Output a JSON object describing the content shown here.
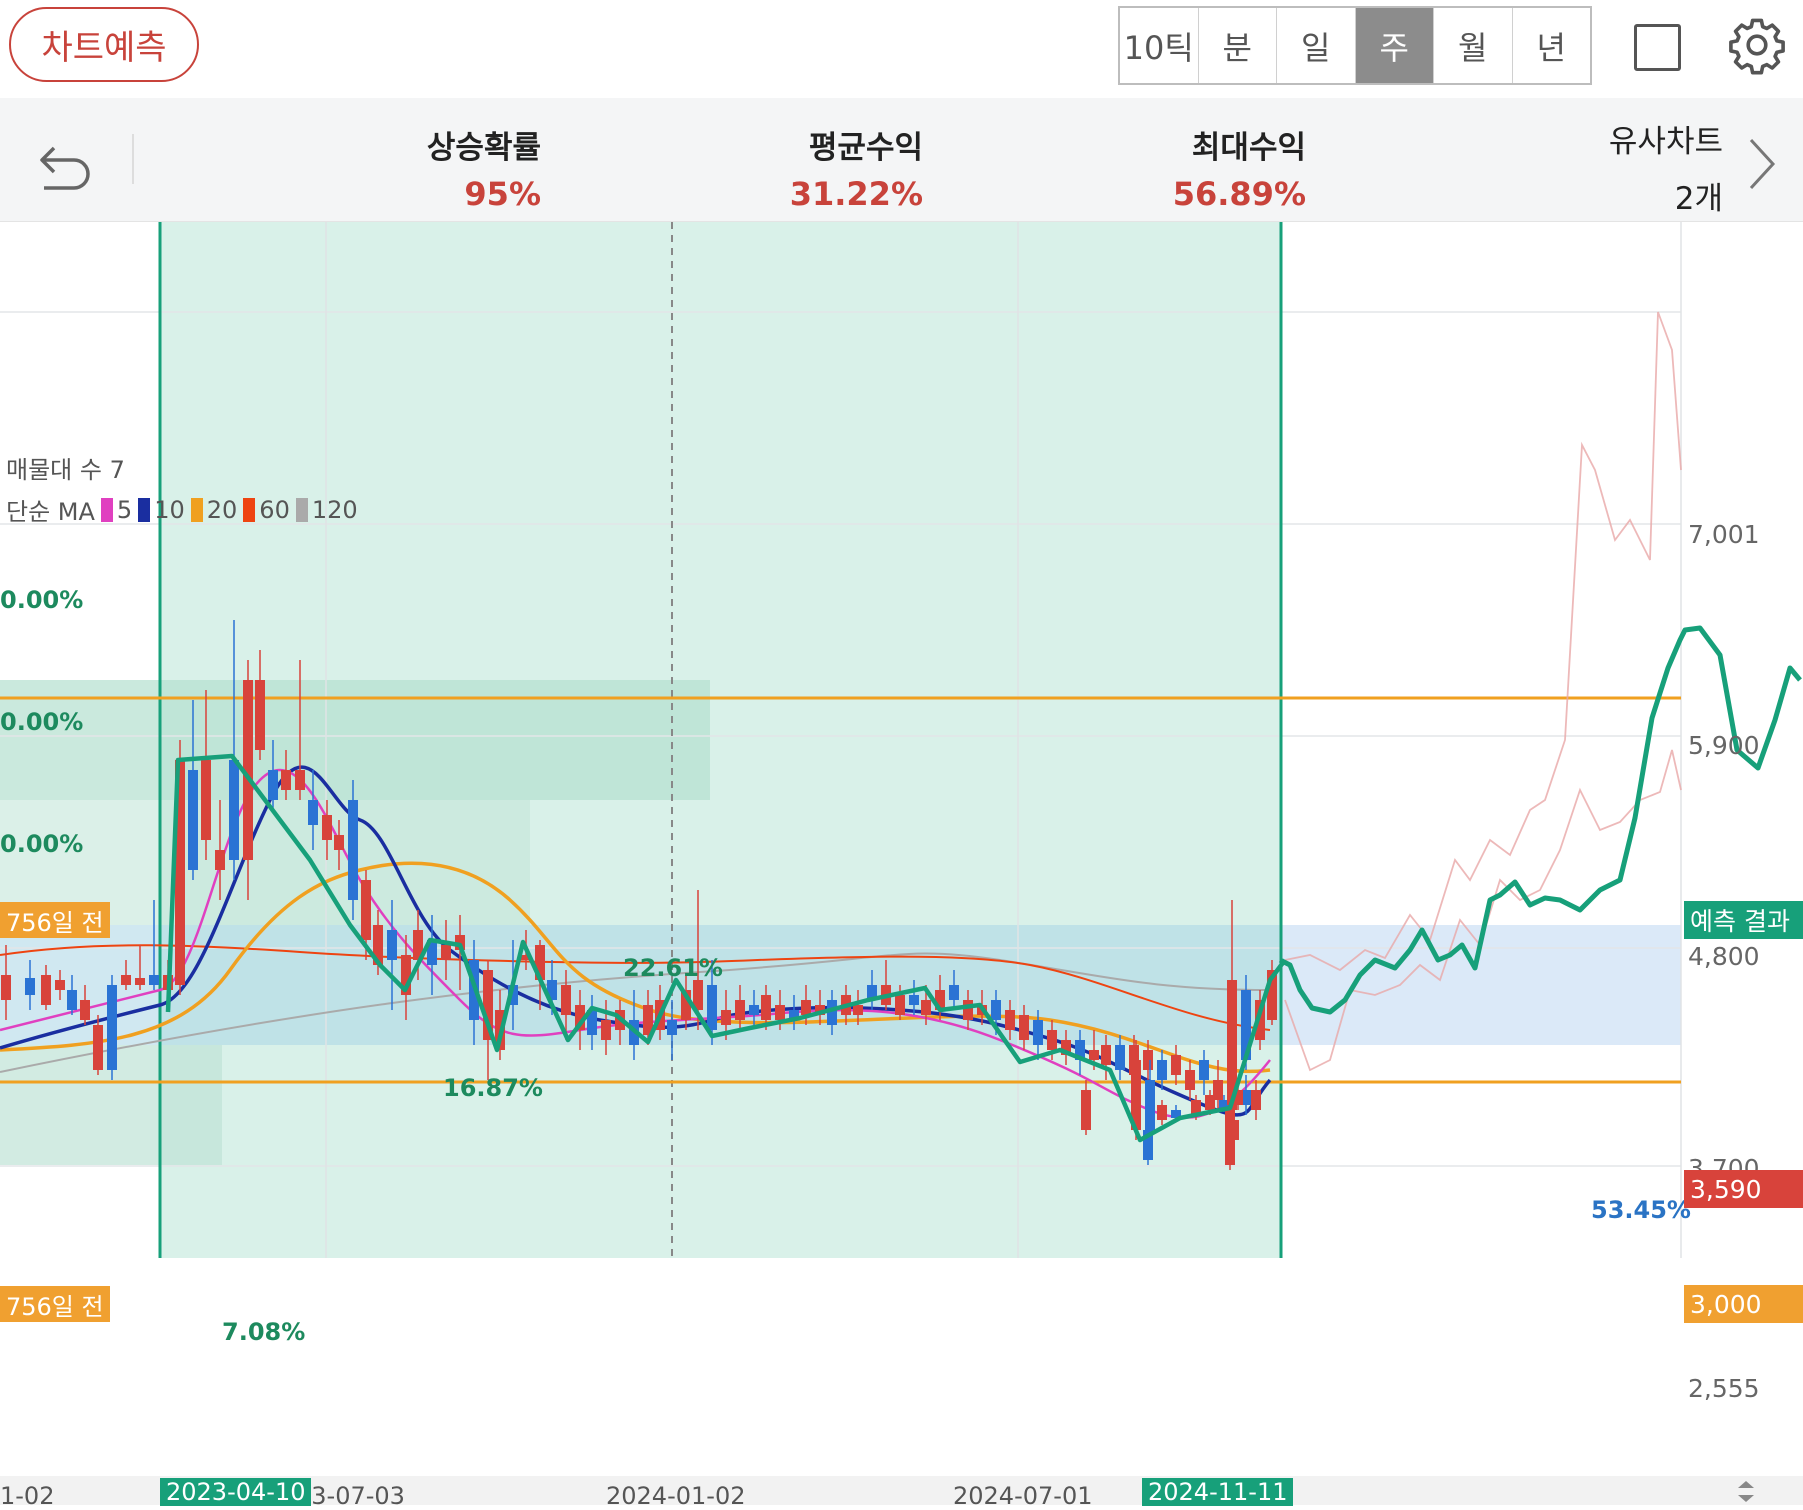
{
  "topbar": {
    "predict_button": "차트예측",
    "periods": [
      {
        "label": "10틱",
        "active": false
      },
      {
        "label": "분",
        "active": false
      },
      {
        "label": "일",
        "active": false
      },
      {
        "label": "주",
        "active": true
      },
      {
        "label": "월",
        "active": false
      },
      {
        "label": "년",
        "active": false
      }
    ],
    "icons": [
      "square-icon",
      "gear-icon"
    ]
  },
  "stats": {
    "rise_probability": {
      "label": "상승확률",
      "value": "95%"
    },
    "avg_return": {
      "label": "평균수익",
      "value": "31.22%"
    },
    "max_return": {
      "label": "최대수익",
      "value": "56.89%"
    },
    "similar_chart": {
      "label": "유사차트",
      "count": "2개"
    },
    "icons": [
      "back-arrow-icon",
      "chevron-right-icon"
    ]
  },
  "chart": {
    "legend_volume_profile": "매물대 수 7",
    "legend_ma_label": "단순 MA",
    "ma_lines": [
      {
        "period": "5",
        "color": "#e040c0"
      },
      {
        "period": "10",
        "color": "#1a2ea0"
      },
      {
        "period": "20",
        "color": "#f0a020"
      },
      {
        "period": "60",
        "color": "#ee4411"
      },
      {
        "period": "120",
        "color": "#aaaaaa"
      }
    ],
    "left_percent_labels": [
      "0.00%",
      "0.00%",
      "0.00%"
    ],
    "day_tags": [
      "756일 전",
      "756일 전"
    ],
    "zone_percents": [
      "22.61%",
      "16.87%",
      "7.08%"
    ],
    "right_zone_percent": "53.45%",
    "y_axis_labels": [
      "7,001",
      "5,900",
      "4,800",
      "3,700",
      "2,555"
    ],
    "price_tag_current": "3,590",
    "price_tag_base": "3,000",
    "result_tag": "예측 결과",
    "x_axis_labels": [
      "1-02",
      "23-07-03",
      "2024-01-02",
      "2024-07-01"
    ],
    "x_axis_tags": [
      "2023-04-10",
      "2024-11-11"
    ],
    "colors": {
      "up": "#d8433b",
      "down": "#2a73d4",
      "pattern": "#17a07a",
      "zone": "#d6f0e8"
    }
  }
}
